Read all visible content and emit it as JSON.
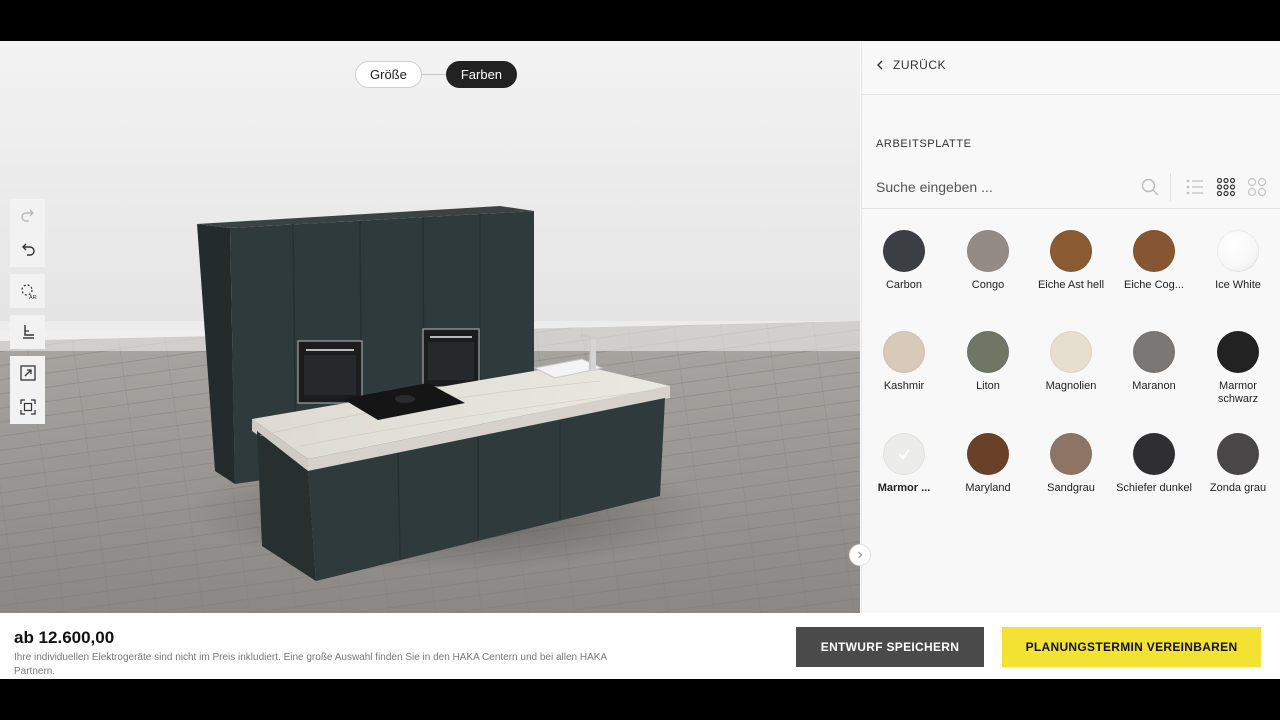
{
  "steps": [
    {
      "label": "Größe",
      "active": false
    },
    {
      "label": "Farben",
      "active": true
    }
  ],
  "tools": [
    "redo-icon",
    "undo-icon",
    "ar-view-icon",
    "measure-icon",
    "expand-icon",
    "fit-view-icon"
  ],
  "panel": {
    "back_label": "ZURÜCK",
    "section_title": "ARBEITSPLATTE",
    "search_placeholder": "Suche eingeben ...",
    "views": [
      "list-view-icon",
      "grid-view-icon",
      "large-grid-view-icon"
    ]
  },
  "swatches": [
    {
      "label": "Carbon",
      "color": "#3b3f43"
    },
    {
      "label": "Congo",
      "color": "#958b86"
    },
    {
      "label": "Eiche Ast hell",
      "color": "#8a5a32"
    },
    {
      "label": "Eiche Cog...",
      "color": "#855631"
    },
    {
      "label": "Ice White",
      "color": "#f7f7f7"
    },
    {
      "label": "Kashmir",
      "color": "#d9c9b9"
    },
    {
      "label": "Liton",
      "color": "#6f7666"
    },
    {
      "label": "Magnolien",
      "color": "#e6dfcf"
    },
    {
      "label": "Maranon",
      "color": "#7b7775"
    },
    {
      "label": "Marmor schwarz",
      "color": "#222222"
    },
    {
      "label": "Marmor ...",
      "color": "#ececea",
      "selected": true
    },
    {
      "label": "Maryland",
      "color": "#6a4029"
    },
    {
      "label": "Sandgrau",
      "color": "#8e7464"
    },
    {
      "label": "Schiefer dunkel",
      "color": "#2f2f31"
    },
    {
      "label": "Zonda grau",
      "color": "#484646"
    }
  ],
  "footer": {
    "price": "ab 12.600,00",
    "note": "Ihre individuellen Elektrogeräte sind nicht im Preis inkludiert. Eine große Auswahl finden Sie in den HAKA Centern und bei allen HAKA Partnern.",
    "save_label": "ENTWURF SPEICHERN",
    "appointment_label": "PLANUNGSTERMIN VEREINBAREN"
  },
  "colors": {
    "accent": "#f4e232",
    "dark": "#222222",
    "cabinet": "#2f3a3c"
  }
}
